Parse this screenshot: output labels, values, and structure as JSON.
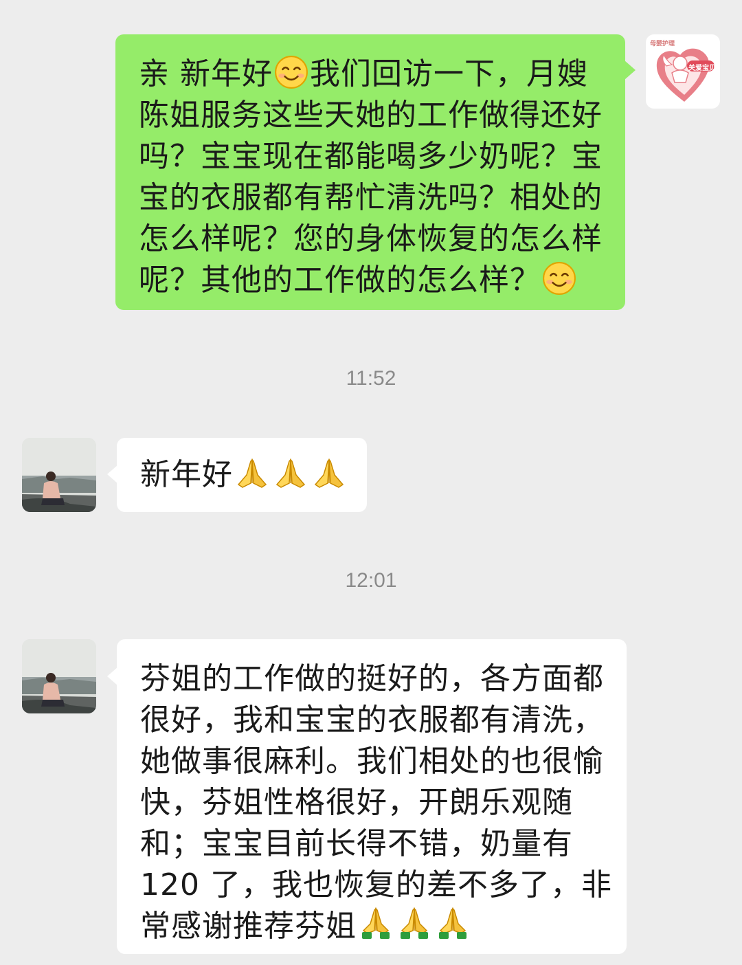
{
  "messages": [
    {
      "type": "outgoing",
      "sender_logo_small_text": "母婴护理",
      "sender_logo_heart_text": "关爱宝贝",
      "parts": [
        "亲 新年好",
        "smiling-face",
        "我们回访一下，月嫂陈姐服务这些天她的工作做得还好吗？宝宝现在都能喝多少奶呢？宝宝的衣服都有帮忙清洗吗？相处的怎么样呢？您的身体恢复的怎么样呢？其他的工作做的怎么样？",
        "smiling-face"
      ]
    },
    {
      "type": "time",
      "text": "11:52"
    },
    {
      "type": "incoming",
      "parts": [
        "新年好",
        "pray-hands-icon",
        "pray-hands-icon",
        "pray-hands-icon"
      ]
    },
    {
      "type": "time",
      "text": "12:01"
    },
    {
      "type": "incoming",
      "parts": [
        "芬姐的工作做的挺好的，各方面都很好，我和宝宝的衣服都有清洗，她做事很麻利。我们相处的也很愉快，芬姐性格很好，开朗乐观随和；宝宝目前长得不错，奶量有120了，我也恢复的差不多了，非常感谢推荐芬姐",
        "pray-hands-icon",
        "pray-hands-icon",
        "pray-hands-icon"
      ]
    }
  ],
  "display": {
    "m1_line1a": "亲 新年好",
    "m1_line1b": "我们回访一下，月嫂",
    "m1_line2": "陈姐服务这些天她的工作做得还好",
    "m1_line3": "吗？宝宝现在都能喝多少奶呢？宝",
    "m1_line4": "宝的衣服都有帮忙清洗吗？相处的",
    "m1_line5": "怎么样呢？您的身体恢复的怎么样",
    "m1_line6": "呢？其他的工作做的怎么样？",
    "time1": "11:52",
    "m2_text": "新年好",
    "time2": "12:01",
    "m3_line1": "芬姐的工作做的挺好的，各方面都",
    "m3_line2": "很好，我和宝宝的衣服都有清洗，",
    "m3_line3": "她做事很麻利。我们相处的也很愉",
    "m3_line4": "快，芬姐性格很好，开朗乐观随",
    "m3_line5": "和；宝宝目前长得不错，奶量有",
    "m3_line6": "120 了，我也恢复的差不多了，非",
    "m3_line7": "常感谢推荐芬姐"
  },
  "colors": {
    "background": "#ededed",
    "outgoing_bubble": "#95ec69",
    "incoming_bubble": "#ffffff",
    "timestamp": "#8a8a8a"
  }
}
